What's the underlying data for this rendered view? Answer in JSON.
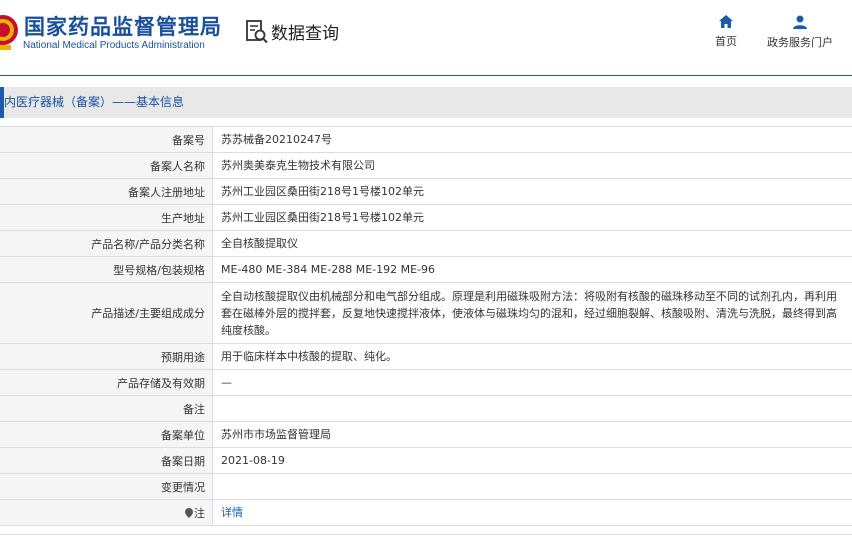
{
  "header": {
    "site_name_cn": "国家药品监督管理局",
    "site_name_en": "National Medical Products Administration",
    "query_label": "数据查询",
    "nav": [
      {
        "label": "首页",
        "icon": "home-icon"
      },
      {
        "label": "政务服务门户",
        "icon": "user-icon"
      }
    ],
    "brand_color": "#1a4f9c"
  },
  "title_bar": {
    "text": "内医疗器械（备案）——基本信息"
  },
  "rows": [
    {
      "label": "备案号",
      "value": "苏苏械备20210247号"
    },
    {
      "label": "备案人名称",
      "value": "苏州奥美泰克生物技术有限公司"
    },
    {
      "label": "备案人注册地址",
      "value": "苏州工业园区桑田街218号1号楼102单元"
    },
    {
      "label": "生产地址",
      "value": "苏州工业园区桑田街218号1号楼102单元"
    },
    {
      "label": "产品名称/产品分类名称",
      "value": "全自核酸提取仪"
    },
    {
      "label": "型号规格/包装规格",
      "value": "ME-480 ME-384 ME-288 ME-192 ME-96"
    },
    {
      "label": "产品描述/主要组成成分",
      "value": "全自动核酸提取仪由机械部分和电气部分组成。原理是利用磁珠吸附方法：将吸附有核酸的磁珠移动至不同的试剂孔内，再利用套在磁棒外层的搅拌套，反复地快速搅拌液体，使液体与磁珠均匀的混和，经过细胞裂解、核酸吸附、清洗与洗脱，最终得到高纯度核酸。"
    },
    {
      "label": "预期用途",
      "value": "用于临床样本中核酸的提取、纯化。"
    },
    {
      "label": "产品存储及有效期",
      "value": "—"
    },
    {
      "label": "备注",
      "value": ""
    },
    {
      "label": "备案单位",
      "value": "苏州市市场监督管理局"
    },
    {
      "label": "备案日期",
      "value": "2021-08-19"
    },
    {
      "label": "变更情况",
      "value": ""
    },
    {
      "label": "注",
      "value": "详情"
    }
  ]
}
